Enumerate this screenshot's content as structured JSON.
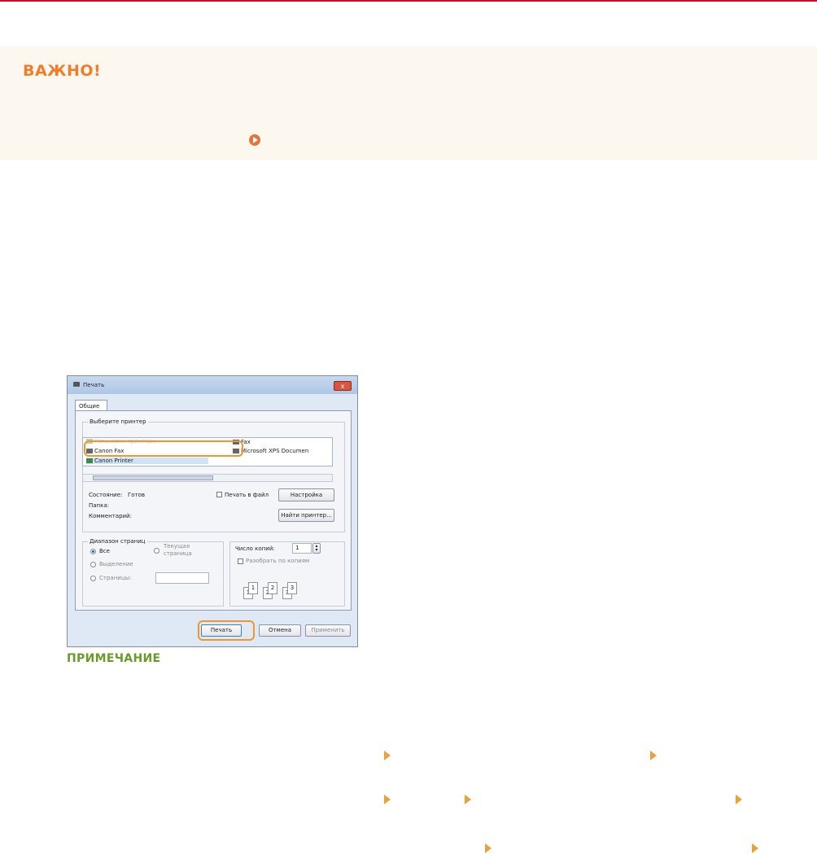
{
  "important": {
    "title": "ВАЖНО!"
  },
  "dialog": {
    "title": "Печать",
    "close_label": "x",
    "tab_general": "Общие",
    "select_printer_label": "Выберите принтер",
    "printers": [
      {
        "name": "Установка принтера",
        "faded": true
      },
      {
        "name": "Canon Fax"
      },
      {
        "name": "Canon Printer"
      },
      {
        "name": "Fax"
      },
      {
        "name": "Microsoft XPS Documen"
      }
    ],
    "status_label": "Состояние:",
    "status_value": "Готов",
    "folder_label": "Папка:",
    "comment_label": "Комментарий:",
    "print_to_file_label": "Печать в файл",
    "settings_button": "Настройка",
    "find_printer_button": "Найти принтер...",
    "page_range_label": "Диапазон страниц",
    "range_all": "Все",
    "range_current_line1": "Текущая",
    "range_current_line2": "страница",
    "range_selection": "Выделение",
    "range_pages": "Страницы:",
    "copies_label": "Число копий:",
    "copies_value": "1",
    "collate_label": "Разобрать по копиям",
    "collate_sheets": [
      "1",
      "1",
      "2",
      "2",
      "3",
      "3"
    ],
    "print_button": "Печать",
    "cancel_button": "Отмена",
    "apply_button": "Применить"
  },
  "note": {
    "title": "ПРИМЕЧАНИЕ"
  },
  "colors": {
    "red_rule": "#c8102e",
    "important_orange": "#f07d2a",
    "highlight_orange": "#f0962f",
    "note_green": "#6a9a2a",
    "arrow_orange": "#e8a23a"
  }
}
